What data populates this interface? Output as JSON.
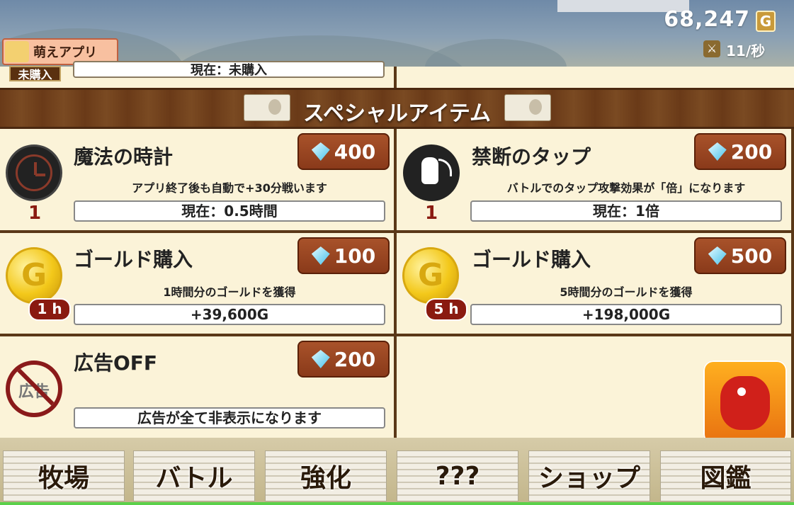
{
  "header": {
    "gold": "68,247",
    "gold_icon": "G",
    "attack_rate": "11/秒",
    "app_badge": "萌えアプリ"
  },
  "previous_row": {
    "tag": "未購入",
    "status": "現在：未購入"
  },
  "section": {
    "title": "スペシャルアイテム"
  },
  "items": [
    {
      "name": "魔法の時計",
      "price": "400",
      "desc": "アプリ終了後も自動で+30分戦います",
      "value": "現在：0.5時間",
      "level": "1",
      "icon": "clock-icon"
    },
    {
      "name": "禁断のタップ",
      "price": "200",
      "desc": "バトルでのタップ攻撃効果が「倍」になります",
      "value": "現在：1倍",
      "level": "1",
      "icon": "tap-hand-icon"
    },
    {
      "name": "ゴールド購入",
      "price": "100",
      "desc": "1時間分のゴールドを獲得",
      "value": "+39,600G",
      "badge": "1 h",
      "icon_text": "G",
      "icon": "gold-coin-icon"
    },
    {
      "name": "ゴールド購入",
      "price": "500",
      "desc": "5時間分のゴールドを獲得",
      "value": "+198,000G",
      "badge": "5 h",
      "icon_text": "G",
      "icon": "gold-coin-icon"
    },
    {
      "name": "広告OFF",
      "price": "200",
      "desc": "",
      "value": "広告が全て非表示になります",
      "icon_text": "広告",
      "icon": "no-ads-icon"
    }
  ],
  "nav": [
    {
      "label": "牧場"
    },
    {
      "label": "バトル"
    },
    {
      "label": "強化"
    },
    {
      "label": "???"
    },
    {
      "label": "ショップ"
    },
    {
      "label": "図鑑"
    }
  ],
  "colors": {
    "panel": "#fbf3d8",
    "frame": "#5a3818",
    "price_button": "#9a4520",
    "level_text": "#8a1a10"
  }
}
